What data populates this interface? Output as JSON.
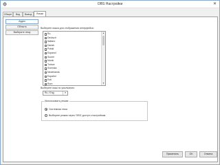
{
  "window": {
    "title": "OBS Настройки"
  },
  "tabs": [
    {
      "label": "Общие"
    },
    {
      "label": "Вид"
    },
    {
      "label": "Вывод"
    },
    {
      "label": "Языки"
    }
  ],
  "sidebar": {
    "items": [
      {
        "label": "Аудио"
      },
      {
        "label": "Область"
      },
      {
        "label": "Выберите тему"
      }
    ]
  },
  "languages": {
    "header": "Выберите языки для отображения интерфейса:",
    "items": [
      "Ru",
      "Deutsch",
      "Italiano",
      "Dansk",
      "Polski",
      "Espanol",
      "Suomi",
      "Norsk",
      "Turkce",
      "Svenska",
      "Nederlands",
      "Español",
      "Esti",
      "Rom"
    ]
  },
  "default_lang": {
    "label": "Выберите язык по умолчанию:",
    "value": "Ru / Eng"
  },
  "mode_group": {
    "title": "Использовать режим:",
    "options": [
      {
        "label": "Системная тема",
        "checked": true
      },
      {
        "label": "Выберите режим через 'OBS'-доступ к настройкам",
        "checked": false
      }
    ]
  },
  "buttons": {
    "apply": "Применить",
    "ok": "OK",
    "cancel": "Отмена"
  }
}
